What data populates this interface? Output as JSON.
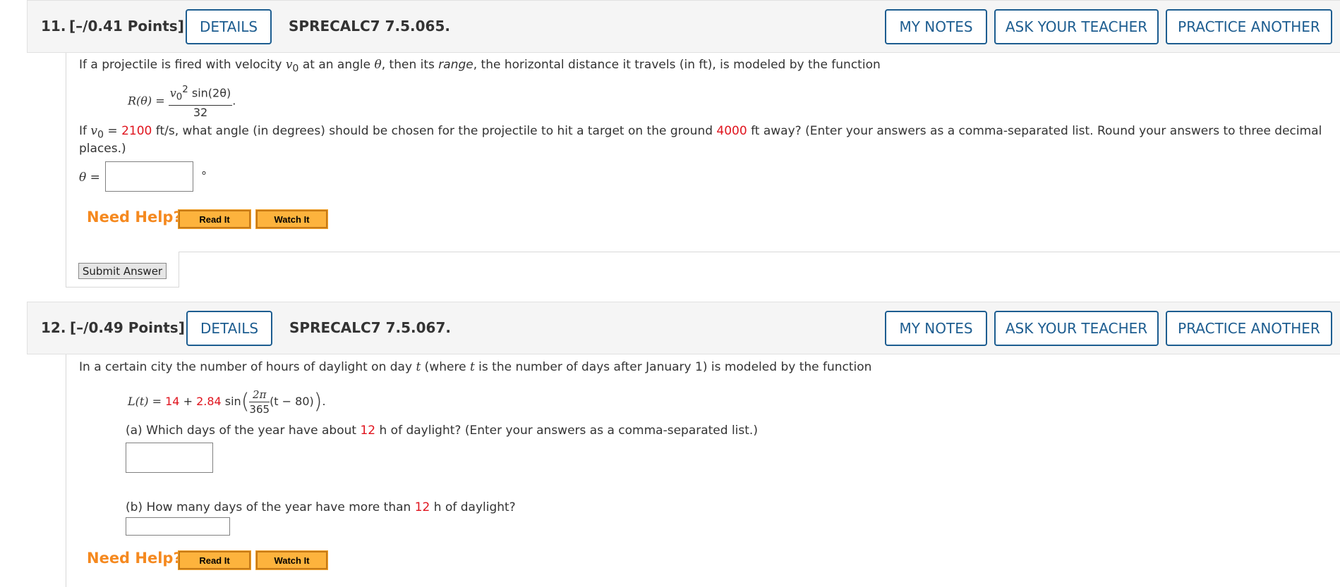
{
  "q11": {
    "number": "11.",
    "points": "[–/0.41 Points]",
    "details": "DETAILS",
    "code": "SPRECALC7 7.5.065.",
    "my_notes": "MY NOTES",
    "ask_teacher": "ASK YOUR TEACHER",
    "practice": "PRACTICE ANOTHER",
    "intro_a": "If a projectile is fired with velocity ",
    "v": "v",
    "sub0": "0",
    "intro_b": " at an angle ",
    "theta": "θ",
    "intro_c": ", then its ",
    "range": "range",
    "intro_d": ", the horizontal distance it travels (in ft), is modeled by the function",
    "formula_lhs": "R(θ) = ",
    "formula_num_v": "v",
    "formula_num_sub": "0",
    "formula_num_sup": "2",
    "formula_num_rest": " sin(2θ)",
    "formula_den": "32",
    "formula_end": ".",
    "cond_if": "If  ",
    "cond_v": "v",
    "cond_sub": "0",
    "cond_eq": " = ",
    "velocity": "2100",
    "cond_mid": " ft/s,  what angle (in degrees) should be chosen for the projectile to hit a target on the ground ",
    "distance": "4000",
    "cond_end": " ft away? (Enter your answers as a comma-separated list. Round your answers to three decimal",
    "cond_line2": "places.)",
    "answer_label": "θ = ",
    "degree": "°",
    "need_help": "Need Help?",
    "read_it": "Read It",
    "watch_it": "Watch It",
    "submit": "Submit Answer"
  },
  "q12": {
    "number": "12.",
    "points": "[–/0.49 Points]",
    "details": "DETAILS",
    "code": "SPRECALC7 7.5.067.",
    "my_notes": "MY NOTES",
    "ask_teacher": "ASK YOUR TEACHER",
    "practice": "PRACTICE ANOTHER",
    "intro_a": "In a certain city the number of hours of daylight on day ",
    "t1": "t",
    "intro_b": " (where ",
    "t2": "t",
    "intro_c": " is the number of days after January 1) is modeled by the function",
    "f_lhs": "L(t) = ",
    "f_a": "14",
    "f_plus": " + ",
    "f_b": "2.84",
    "f_sin": " sin",
    "f_num": "2π",
    "f_den": "365",
    "f_tail": "(t − 80)",
    "f_end": ".",
    "part_a_pre": "(a) Which days of the year have about ",
    "part_a_val": "12",
    "part_a_post": " h of daylight? (Enter your answers as a comma-separated list.)",
    "part_b_pre": "(b) How many days of the year have more than ",
    "part_b_val": "12",
    "part_b_post": " h of daylight?",
    "need_help": "Need Help?",
    "read_it": "Read It",
    "watch_it": "Watch It"
  },
  "colors": {
    "accent_blue": "#1d5d90",
    "red": "#e0141e",
    "need_help_orange": "#f5891f",
    "help_button": "#fdb33d"
  }
}
